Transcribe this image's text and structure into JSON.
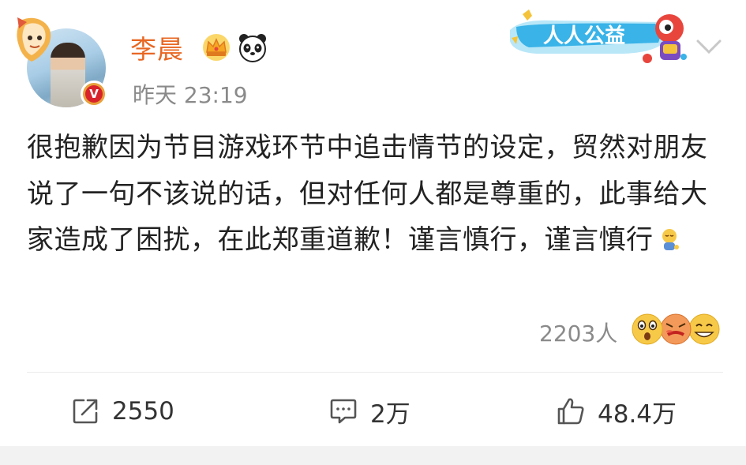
{
  "post": {
    "author": {
      "name": "李晨",
      "avatar_icon": "avatar-icon",
      "badges": [
        "crown-icon",
        "panda-icon"
      ],
      "verified_badge": "V"
    },
    "timestamp": "昨天 23:19",
    "banner": {
      "text": "人人公益",
      "icon": "charity-mascot-icon"
    },
    "content": {
      "text": "很抱歉因为节目游戏环节中追击情节的设定，贸然对朋友说了一句不该说的话，但对任何人都是尊重的，此事给大家造成了困扰，在此郑重道歉！谨言慎行，谨言慎行",
      "trailing_emoji": "bow-emoji"
    },
    "reactions": {
      "count": "2203人",
      "emojis": [
        "shocked-face-emoji",
        "angry-face-emoji",
        "grin-face-emoji"
      ]
    },
    "actions": {
      "repost": {
        "icon": "share-icon",
        "count": "2550"
      },
      "comment": {
        "icon": "comment-icon",
        "count": "2万"
      },
      "like": {
        "icon": "thumbs-up-icon",
        "count": "48.4万"
      }
    }
  },
  "colors": {
    "username": "#e86722",
    "secondary_text": "#8a8a8a",
    "verified": "#e8a13b",
    "banner_blue": "#2fa9e3"
  }
}
